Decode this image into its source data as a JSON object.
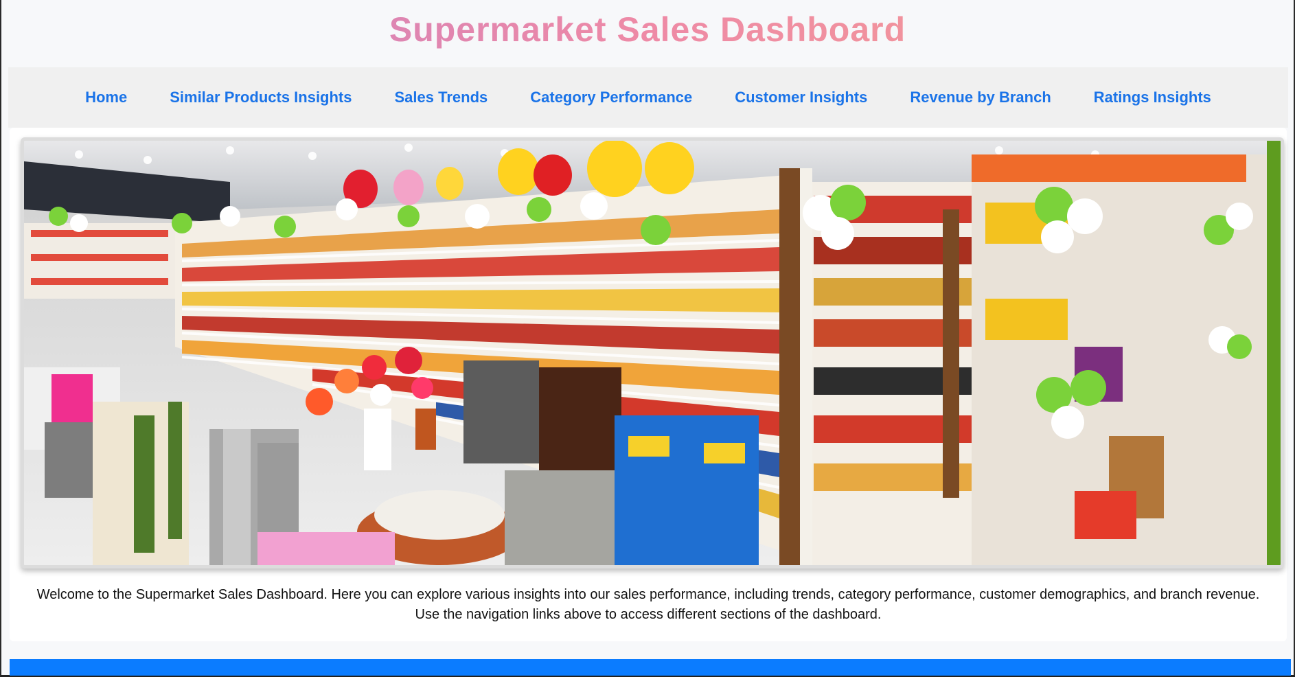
{
  "header": {
    "title": "Supermarket Sales Dashboard"
  },
  "nav": {
    "home": "Home",
    "similar_products": "Similar Products Insights",
    "sales_trends": "Sales Trends",
    "category_performance": "Category Performance",
    "customer_insights": "Customer Insights",
    "revenue_by_branch": "Revenue by Branch",
    "ratings_insights": "Ratings Insights"
  },
  "hero": {
    "image_name": "supermarket-aisle-image"
  },
  "welcome": {
    "line1": "Welcome to the Supermarket Sales Dashboard. Here you can explore various insights into our sales performance, including trends, category performance, customer demographics, and branch revenue.",
    "line2": "Use the navigation links above to access different sections of the dashboard."
  },
  "colors": {
    "accent": "#1a73e8",
    "footer": "#0b7cff",
    "title_from": "#c57ec4",
    "title_to": "#f6a090"
  }
}
